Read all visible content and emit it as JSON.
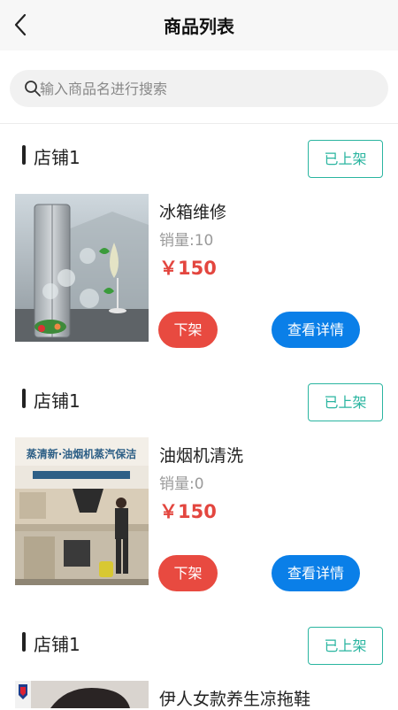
{
  "header": {
    "title": "商品列表",
    "back_icon": "chevron-left-icon"
  },
  "search": {
    "placeholder": "输入商品名进行搜索",
    "icon": "search-icon"
  },
  "colors": {
    "status_border": "#2ab5a0",
    "price": "#e3463f",
    "offline_button": "#e84a40",
    "detail_button": "#0a7fe8"
  },
  "products": [
    {
      "store": "店铺1",
      "status_label": "已上架",
      "name": "冰箱维修",
      "sales": "销量:10",
      "price": "￥150",
      "offline_label": "下架",
      "detail_label": "查看详情",
      "image": "refrigerator-photo"
    },
    {
      "store": "店铺1",
      "status_label": "已上架",
      "name": "油烟机清洗",
      "sales": "销量:0",
      "price": "￥150",
      "offline_label": "下架",
      "detail_label": "查看详情",
      "image": "range-hood-cleaning-photo",
      "image_text": "蒸清新·油烟机蒸汽保洁"
    },
    {
      "store": "店铺1",
      "status_label": "已上架",
      "name": "伊人女款养生凉拖鞋",
      "image": "slipper-photo"
    }
  ]
}
